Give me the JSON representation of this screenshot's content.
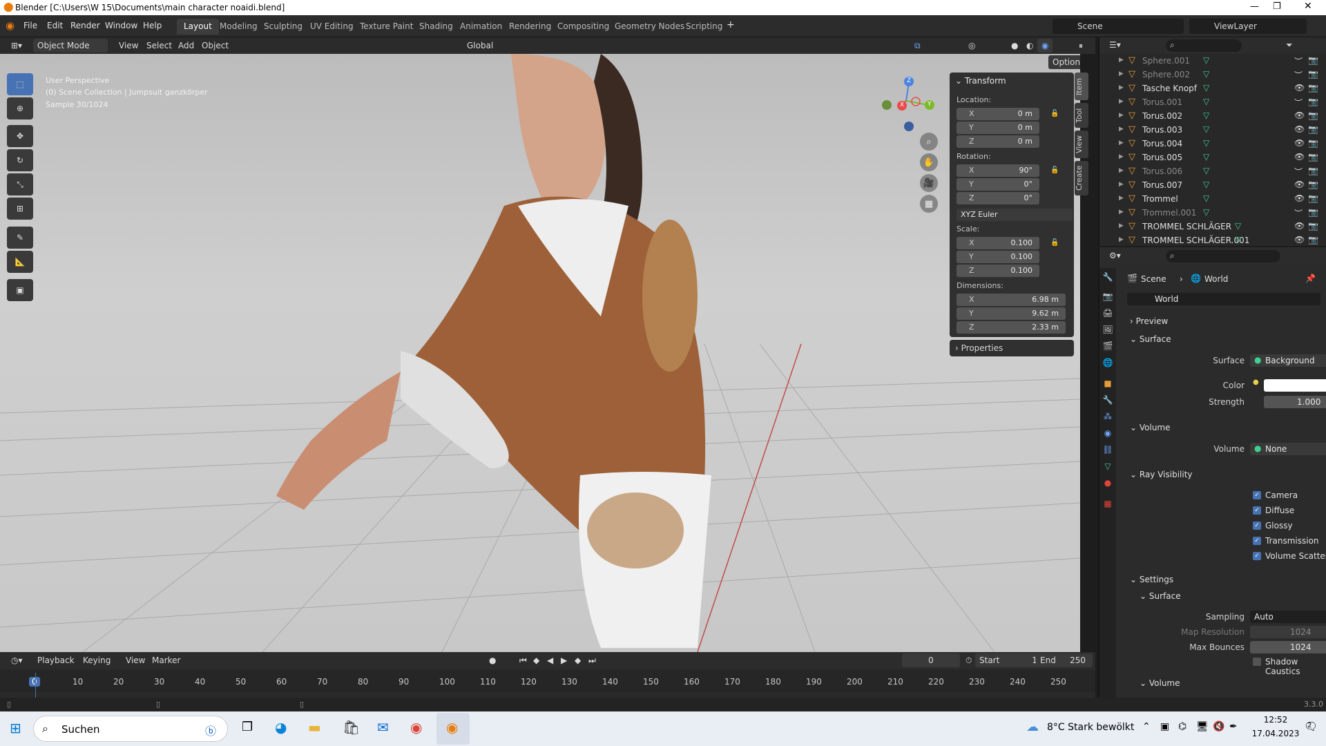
{
  "window": {
    "title": "Blender [C:\\Users\\W 15\\Documents\\main character noaidi.blend]"
  },
  "menus": [
    "File",
    "Edit",
    "Render",
    "Window",
    "Help"
  ],
  "workspaces": [
    "Layout",
    "Modeling",
    "Sculpting",
    "UV Editing",
    "Texture Paint",
    "Shading",
    "Animation",
    "Rendering",
    "Compositing",
    "Geometry Nodes",
    "Scripting"
  ],
  "scene": {
    "name": "Scene",
    "view_layer": "ViewLayer"
  },
  "header3d": {
    "mode": "Object Mode",
    "view": "View",
    "select": "Select",
    "add": "Add",
    "object": "Object",
    "orientation": "Global",
    "options": "Options"
  },
  "viewport": {
    "perspective": "User Perspective",
    "collection": "(0) Scene Collection | Jumpsuit ganzkörper",
    "sample": "Sample 30/1024"
  },
  "gizmo": {
    "z": "Z",
    "x": "X",
    "y": "Y"
  },
  "transform": {
    "title": "Transform",
    "location_label": "Location:",
    "location": [
      {
        "axis": "X",
        "value": "0 m"
      },
      {
        "axis": "Y",
        "value": "0 m"
      },
      {
        "axis": "Z",
        "value": "0 m"
      }
    ],
    "rotation_label": "Rotation:",
    "rotation": [
      {
        "axis": "X",
        "value": "90°"
      },
      {
        "axis": "Y",
        "value": "0°"
      },
      {
        "axis": "Z",
        "value": "0°"
      }
    ],
    "rotation_mode": "XYZ Euler",
    "scale_label": "Scale:",
    "scale": [
      {
        "axis": "X",
        "value": "0.100"
      },
      {
        "axis": "Y",
        "value": "0.100"
      },
      {
        "axis": "Z",
        "value": "0.100"
      }
    ],
    "dimensions_label": "Dimensions:",
    "dimensions": [
      {
        "axis": "X",
        "value": "6.98 m"
      },
      {
        "axis": "Y",
        "value": "9.62 m"
      },
      {
        "axis": "Z",
        "value": "2.33 m"
      }
    ],
    "properties": "Properties"
  },
  "side_tabs": [
    "Item",
    "Tool",
    "View",
    "Create"
  ],
  "outliner": [
    {
      "name": "Sphere.001",
      "dim": true
    },
    {
      "name": "Sphere.002",
      "dim": true
    },
    {
      "name": "Tasche Knopf",
      "dim": false
    },
    {
      "name": "Torus.001",
      "dim": true
    },
    {
      "name": "Torus.002",
      "dim": false
    },
    {
      "name": "Torus.003",
      "dim": false
    },
    {
      "name": "Torus.004",
      "dim": false
    },
    {
      "name": "Torus.005",
      "dim": false
    },
    {
      "name": "Torus.006",
      "dim": true
    },
    {
      "name": "Torus.007",
      "dim": false
    },
    {
      "name": "Trommel",
      "dim": false
    },
    {
      "name": "Trommel.001",
      "dim": true
    },
    {
      "name": "TROMMEL SCHLÄGER",
      "dim": false
    },
    {
      "name": "TROMMEL SCHLÄGER.001",
      "dim": false
    }
  ],
  "properties": {
    "breadcrumb": [
      "Scene",
      "World"
    ],
    "world_name": "World",
    "preview": "Preview",
    "surface_section": "Surface",
    "surface_label": "Surface",
    "surface_value": "Background",
    "color_label": "Color",
    "strength_label": "Strength",
    "strength_value": "1.000",
    "volume_section": "Volume",
    "volume_label": "Volume",
    "volume_value": "None",
    "ray_visibility": "Ray Visibility",
    "rays": [
      "Camera",
      "Diffuse",
      "Glossy",
      "Transmission",
      "Volume Scatter"
    ],
    "settings": "Settings",
    "settings_surface": "Surface",
    "sampling_label": "Sampling",
    "sampling_value": "Auto",
    "map_res_label": "Map Resolution",
    "map_res_value": "1024",
    "max_bounces_label": "Max Bounces",
    "max_bounces_value": "1024",
    "shadow_caustics": "Shadow Caustics",
    "settings_volume": "Volume"
  },
  "timeline": {
    "playback": "Playback",
    "keying": "Keying",
    "view": "View",
    "marker": "Marker",
    "current": "0",
    "start_label": "Start",
    "start": "1",
    "end_label": "End",
    "end": "250",
    "ticks": [
      "0",
      "10",
      "20",
      "30",
      "40",
      "50",
      "60",
      "70",
      "80",
      "90",
      "100",
      "110",
      "120",
      "130",
      "140",
      "150",
      "160",
      "170",
      "180",
      "190",
      "200",
      "210",
      "220",
      "230",
      "240",
      "250"
    ]
  },
  "status": {
    "version": "3.3.0"
  },
  "taskbar": {
    "search": "Suchen",
    "weather": "8°C  Stark bewölkt",
    "time": "12:52",
    "date": "17.04.2023",
    "notifications": "2"
  }
}
